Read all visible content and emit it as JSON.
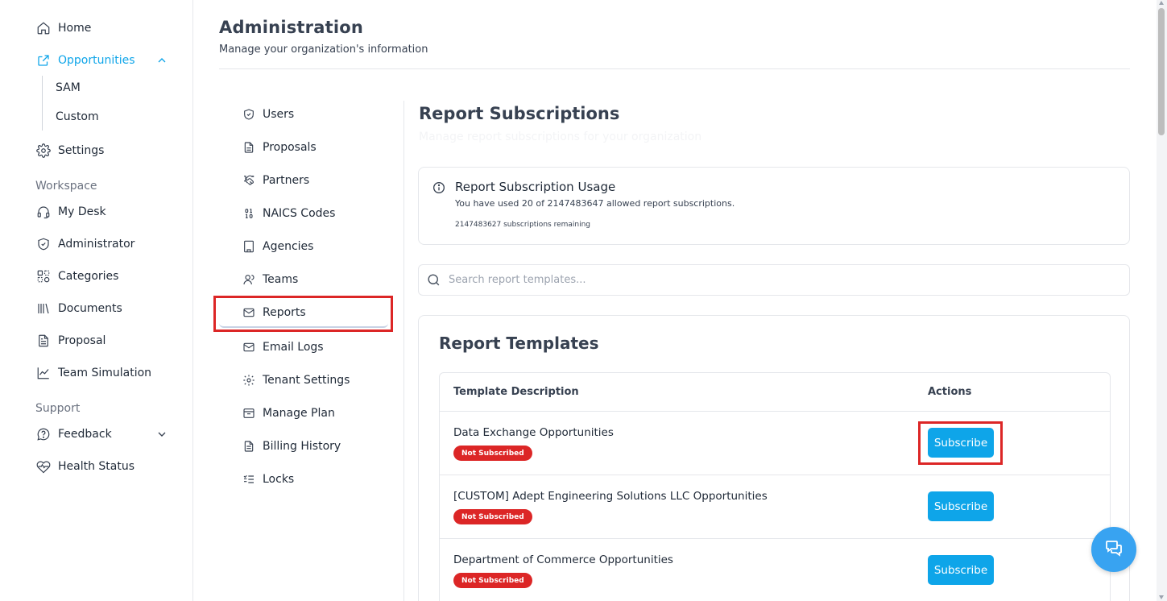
{
  "sidebar": {
    "home": "Home",
    "opportunities": "Opportunities",
    "sub_items": [
      "SAM",
      "Custom"
    ],
    "settings": "Settings",
    "workspace_label": "Workspace",
    "workspace_items": [
      "My Desk",
      "Administrator",
      "Categories",
      "Documents",
      "Proposal",
      "Team Simulation"
    ],
    "support_label": "Support",
    "support_items": [
      "Feedback",
      "Health Status"
    ]
  },
  "header": {
    "title": "Administration",
    "subtitle": "Manage your organization's information"
  },
  "admin_menu": {
    "items": [
      "Users",
      "Proposals",
      "Partners",
      "NAICS Codes",
      "Agencies",
      "Teams",
      "Reports",
      "Email Logs",
      "Tenant Settings",
      "Manage Plan",
      "Billing History",
      "Locks"
    ],
    "active": "Reports"
  },
  "content": {
    "title": "Report Subscriptions",
    "subtitle": "Manage report subscriptions for your organization",
    "usage": {
      "title": "Report Subscription Usage",
      "line": "You have used 20 of 2147483647 allowed report subscriptions.",
      "remaining": "2147483627 subscriptions remaining"
    },
    "search": {
      "placeholder": "Search report templates..."
    },
    "templates": {
      "title": "Report Templates",
      "columns": [
        "Template Description",
        "Actions"
      ],
      "rows": [
        {
          "name": "Data Exchange Opportunities",
          "status": "Not Subscribed",
          "action": "Subscribe"
        },
        {
          "name": "[CUSTOM] Adept Engineering Solutions LLC Opportunities",
          "status": "Not Subscribed",
          "action": "Subscribe"
        },
        {
          "name": "Department of Commerce Opportunities",
          "status": "Not Subscribed",
          "action": "Subscribe"
        }
      ]
    }
  },
  "colors": {
    "accent": "#0ea5e9",
    "danger": "#dc2626",
    "highlight_box": "#dc2626"
  }
}
